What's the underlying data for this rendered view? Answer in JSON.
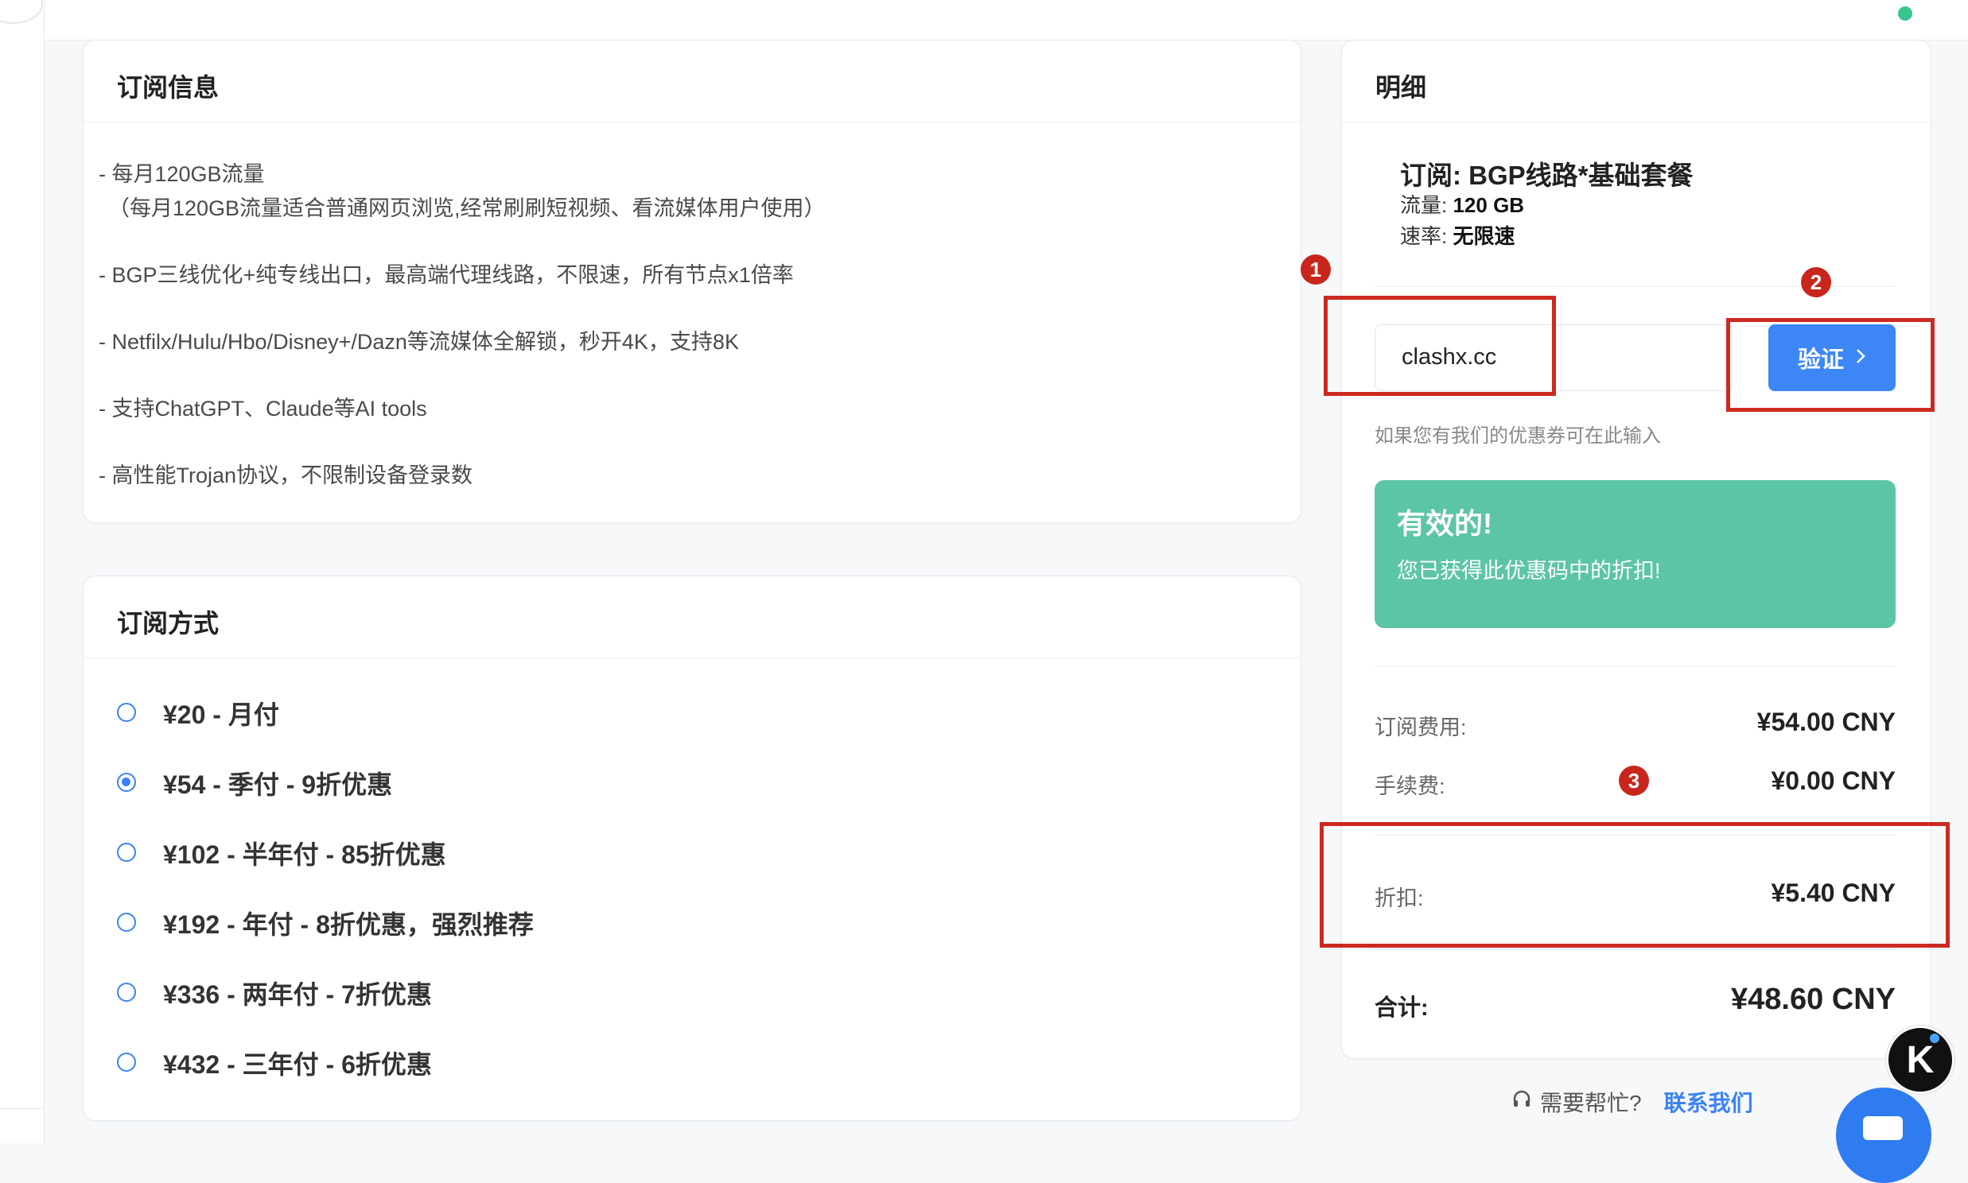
{
  "subscription_info": {
    "title": "订阅信息",
    "lines": [
      "- 每月120GB流量",
      "（每月120GB流量适合普通网页浏览,经常刷刷短视频、看流媒体用户使用）",
      "- BGP三线优化+纯专线出口，最高端代理线路，不限速，所有节点x1倍率",
      "- Netfilx/Hulu/Hbo/Disney+/Dazn等流媒体全解锁，秒开4K，支持8K",
      "- 支持ChatGPT、Claude等AI tools",
      "- 高性能Trojan协议，不限制设备登录数"
    ]
  },
  "subscription_method": {
    "title": "订阅方式",
    "options": [
      {
        "label": "¥20 - 月付",
        "checked": false
      },
      {
        "label": "¥54 - 季付 - 9折优惠",
        "checked": true
      },
      {
        "label": "¥102 - 半年付 - 85折优惠",
        "checked": false
      },
      {
        "label": "¥192 - 年付 - 8折优惠，强烈推荐",
        "checked": false
      },
      {
        "label": "¥336 - 两年付 - 7折优惠",
        "checked": false
      },
      {
        "label": "¥432 - 三年付 - 6折优惠",
        "checked": false
      }
    ]
  },
  "details": {
    "title": "明细",
    "plan": "订阅: BGP线路*基础套餐",
    "traffic_key": "流量:",
    "traffic_value": "120 GB",
    "speed_key": "速率:",
    "speed_value": "无限速",
    "coupon_value": "clashx.cc",
    "verify_label": "验证",
    "coupon_hint": "如果您有我们的优惠券可在此输入",
    "alert_title": "有效的!",
    "alert_text": "您已获得此优惠码中的折扣!",
    "fee_label": "订阅费用:",
    "fee_value": "¥54.00 CNY",
    "handling_label": "手续费:",
    "handling_value": "¥0.00 CNY",
    "discount_label": "折扣:",
    "discount_value": "¥5.40 CNY",
    "total_label": "合计:",
    "total_value": "¥48.60 CNY"
  },
  "help": {
    "text": "需要帮忙?",
    "link": "联系我们"
  },
  "annotations": [
    "1",
    "2",
    "3"
  ],
  "logo_letter": "K",
  "colors": {
    "accent": "#3d86f6",
    "success": "#5cc5a6",
    "annotation": "#cc2a21"
  }
}
